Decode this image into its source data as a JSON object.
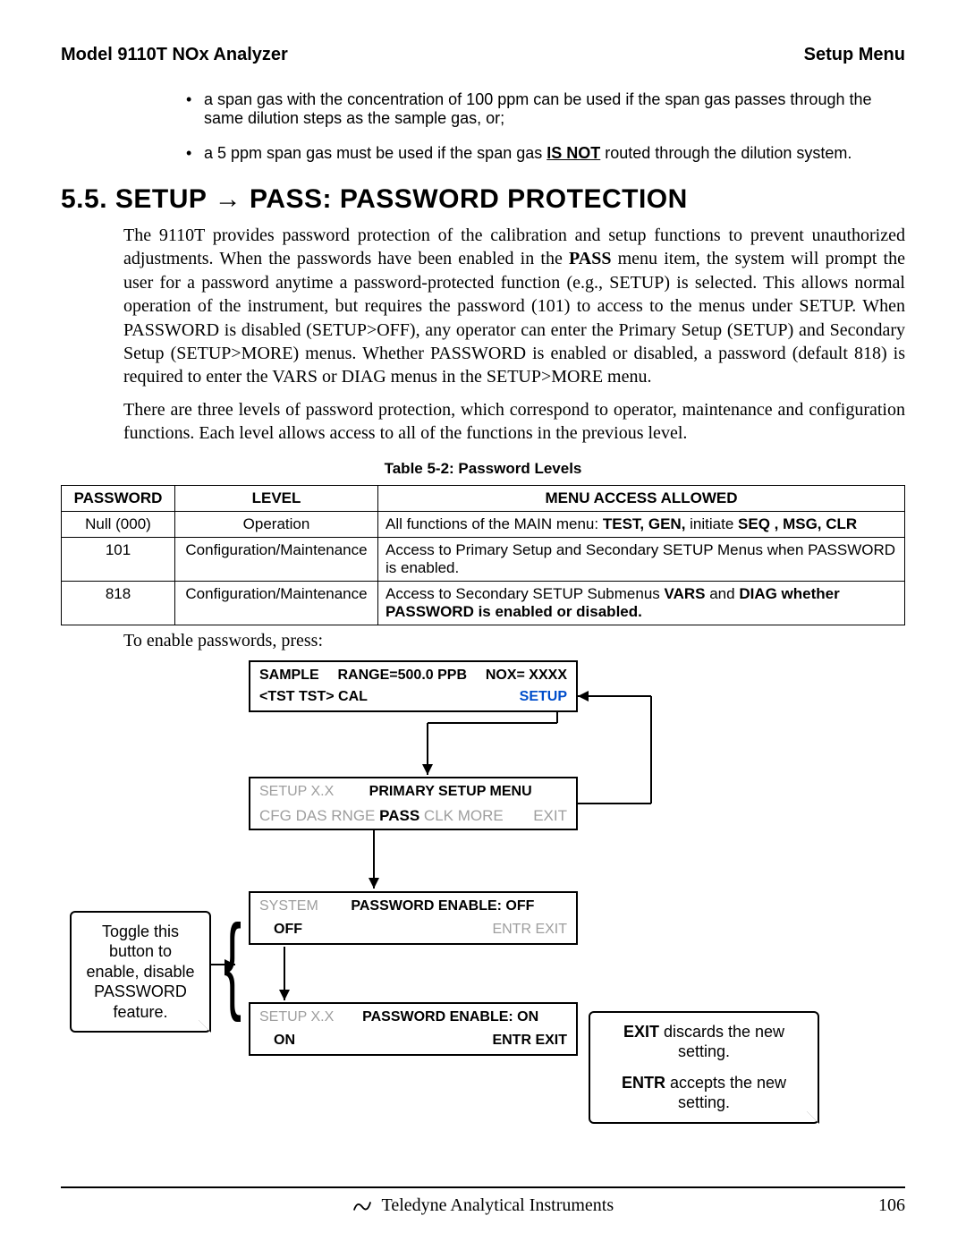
{
  "header": {
    "left": "Model 9110T NOx Analyzer",
    "right": "Setup Menu"
  },
  "bullets": [
    "a span gas with the concentration of 100 ppm can be used if the span gas passes through the same dilution steps as the sample gas, or;",
    "a 5 ppm span gas must be used if the span gas IS NOT routed through the dilution system."
  ],
  "section": {
    "num": "5.5.",
    "title": "SETUP → PASS: PASSWORD PROTECTION"
  },
  "para1": "The 9110T provides password protection of the calibration and setup functions to prevent unauthorized adjustments.  When the passwords have been enabled in the PASS menu item, the system will prompt the user for a password anytime a password-protected function (e.g., SETUP) is selected. This allows normal operation of the instrument, but requires the password (101) to access to the menus under SETUP. When PASSWORD is disabled (SETUP>OFF), any operator can enter the Primary Setup (SETUP) and Secondary Setup (SETUP>MORE) menus. Whether PASSWORD is enabled or disabled, a password (default 818) is required to enter the VARS or DIAG menus in the SETUP>MORE menu.",
  "para2": "There are three levels of password protection, which correspond to operator, maintenance and configuration functions.  Each level allows access to all of the functions in the previous level.",
  "table": {
    "caption": "Table 5-2:   Password Levels",
    "headers": [
      "PASSWORD",
      "LEVEL",
      "MENU ACCESS ALLOWED"
    ],
    "rows": [
      {
        "pw": "Null (000)",
        "lvl": "Operation",
        "acc": "All functions of the MAIN menu: TEST, GEN, initiate SEQ , MSG, CLR"
      },
      {
        "pw": "101",
        "lvl": "Configuration/Maintenance",
        "acc": "Access to Primary Setup and Secondary SETUP Menus when PASSWORD is enabled."
      },
      {
        "pw": "818",
        "lvl": "Configuration/Maintenance",
        "acc": "Access to Secondary SETUP Submenus VARS and DIAG whether PASSWORD is enabled or disabled."
      }
    ]
  },
  "after_table": "To enable passwords, press:",
  "diagram": {
    "box1": {
      "l1_left": "SAMPLE",
      "l1_mid": "RANGE=500.0 PPB",
      "l1_right": "NOX= XXXX",
      "l2_left": "<TST   TST>   CAL",
      "l2_right": "SETUP"
    },
    "box2": {
      "l1_left": "SETUP X.X",
      "l1_mid": "PRIMARY SETUP MENU",
      "l2_left": "CFG   DAS   RNGE",
      "l2_pass": "PASS",
      "l2_after": "CLK   MORE",
      "l2_right": "EXIT"
    },
    "box3": {
      "l1_left": "SYSTEM",
      "l1_mid": "PASSWORD ENABLE: OFF",
      "l2_left": "OFF",
      "l2_right": "ENTR  EXIT"
    },
    "box4": {
      "l1_left": "SETUP X.X",
      "l1_mid": "PASSWORD ENABLE: ON",
      "l2_left": "ON",
      "l2_right": "ENTR  EXIT"
    },
    "callout_left": "Toggle this button to enable, disable PASSWORD feature.",
    "callout_right": "EXIT discards the new setting.\n\nENTR accepts the new setting."
  },
  "footer": {
    "company": "Teledyne Analytical Instruments",
    "page": "106"
  }
}
